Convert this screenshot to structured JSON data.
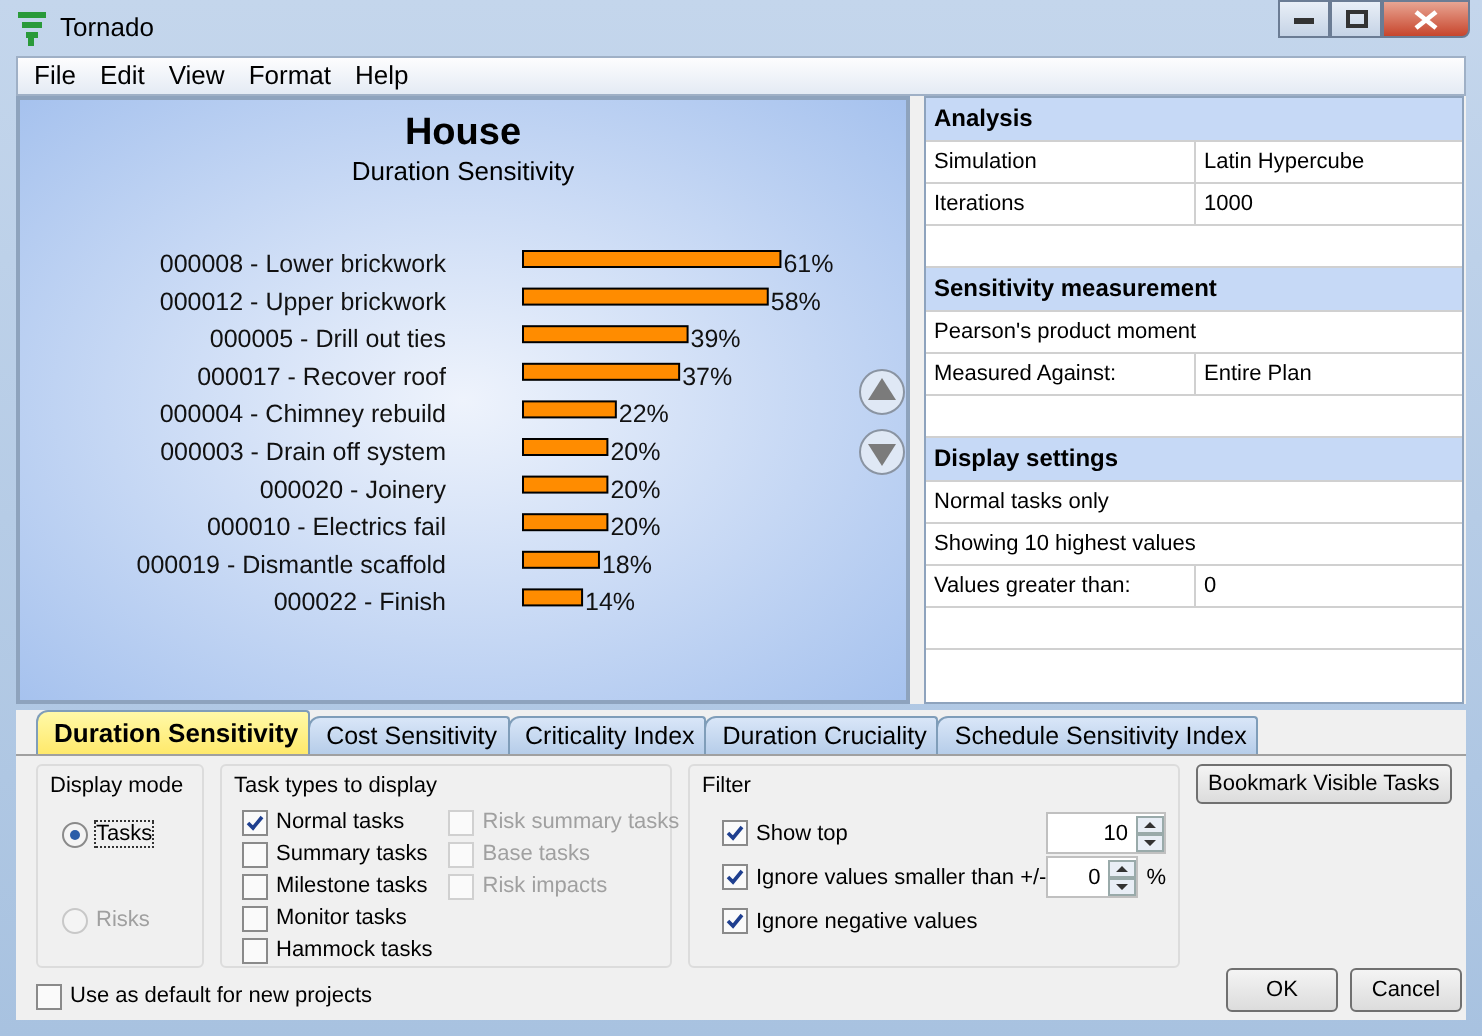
{
  "window": {
    "title": "Tornado"
  },
  "menu": [
    "File",
    "Edit",
    "View",
    "Format",
    "Help"
  ],
  "chart": {
    "title": "House",
    "subtitle": "Duration Sensitivity",
    "chart_data": {
      "type": "bar",
      "orientation": "horizontal",
      "categories": [
        "000008 - Lower brickwork",
        "000012 - Upper brickwork",
        "000005 - Drill out ties",
        "000017 - Recover roof",
        "000004 - Chimney rebuild",
        "000003 - Drain off system",
        "000020 - Joinery",
        "000010 - Electrics fail",
        "000019 - Dismantle scaffold",
        "000022 - Finish"
      ],
      "values": [
        61,
        58,
        39,
        37,
        22,
        20,
        20,
        20,
        18,
        14
      ],
      "value_labels": [
        "61%",
        "58%",
        "39%",
        "37%",
        "22%",
        "20%",
        "20%",
        "20%",
        "18%",
        "14%"
      ]
    }
  },
  "properties": [
    {
      "title": "Analysis",
      "rows": [
        {
          "label": "Simulation",
          "value": "Latin Hypercube"
        },
        {
          "label": "Iterations",
          "value": "1000"
        }
      ]
    },
    {
      "title": "Sensitivity measurement",
      "rows": [
        {
          "label": "Pearson's product moment"
        },
        {
          "label": "Measured Against:",
          "value": "Entire Plan"
        }
      ]
    },
    {
      "title": "Display settings",
      "rows": [
        {
          "label": "Normal tasks only"
        },
        {
          "label": "Showing 10 highest values"
        },
        {
          "label": "Values greater than:",
          "value": "0"
        }
      ]
    }
  ],
  "tabs": [
    {
      "label": "Duration Sensitivity",
      "selected": true
    },
    {
      "label": "Cost Sensitivity",
      "selected": false
    },
    {
      "label": "Criticality Index",
      "selected": false
    },
    {
      "label": "Duration Cruciality",
      "selected": false
    },
    {
      "label": "Schedule Sensitivity Index",
      "selected": false
    }
  ],
  "display_mode": {
    "title": "Display mode",
    "options": [
      {
        "label": "Tasks",
        "selected": true,
        "disabled": false
      },
      {
        "label": "Risks",
        "selected": false,
        "disabled": true
      }
    ]
  },
  "task_types": {
    "title": "Task types to display",
    "columns": [
      [
        {
          "label": "Normal tasks",
          "checked": true,
          "disabled": false
        },
        {
          "label": "Summary tasks",
          "checked": false,
          "disabled": false
        },
        {
          "label": "Milestone tasks",
          "checked": false,
          "disabled": false
        },
        {
          "label": "Monitor tasks",
          "checked": false,
          "disabled": false
        },
        {
          "label": "Hammock tasks",
          "checked": false,
          "disabled": false
        }
      ],
      [
        {
          "label": "Risk summary tasks",
          "checked": false,
          "disabled": true
        },
        {
          "label": "Base tasks",
          "checked": false,
          "disabled": true
        },
        {
          "label": "Risk impacts",
          "checked": false,
          "disabled": true
        }
      ]
    ]
  },
  "filter": {
    "title": "Filter",
    "items": [
      {
        "label": "Show top",
        "checked": true,
        "value": "10"
      },
      {
        "label": "Ignore values smaller than +/-",
        "checked": true,
        "value": "0",
        "unit": "%"
      },
      {
        "label": "Ignore negative values",
        "checked": true
      }
    ]
  },
  "bookmark_button": "Bookmark Visible Tasks",
  "default_option": {
    "label": "Use as default for new projects",
    "checked": false
  },
  "buttons": [
    "OK",
    "Cancel"
  ]
}
